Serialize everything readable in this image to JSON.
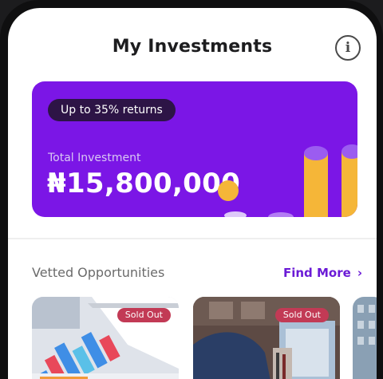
{
  "header": {
    "title": "My Investments",
    "info_icon": "info-circle-icon"
  },
  "summary_card": {
    "badge": "Up to 35% returns",
    "total_label": "Total Investment",
    "total_value": "₦15,800,000",
    "colors": {
      "card": "#7b16e6",
      "badge": "#2d1446",
      "accent": "#f5b638"
    }
  },
  "opportunities": {
    "title": "Vetted Opportunities",
    "find_more": "Find More",
    "items": [
      {
        "status": "Sold Out",
        "image": "analytics-charts-image"
      },
      {
        "status": "Sold Out",
        "image": "businessman-laptop-image"
      },
      {
        "image": "building-image"
      }
    ]
  }
}
